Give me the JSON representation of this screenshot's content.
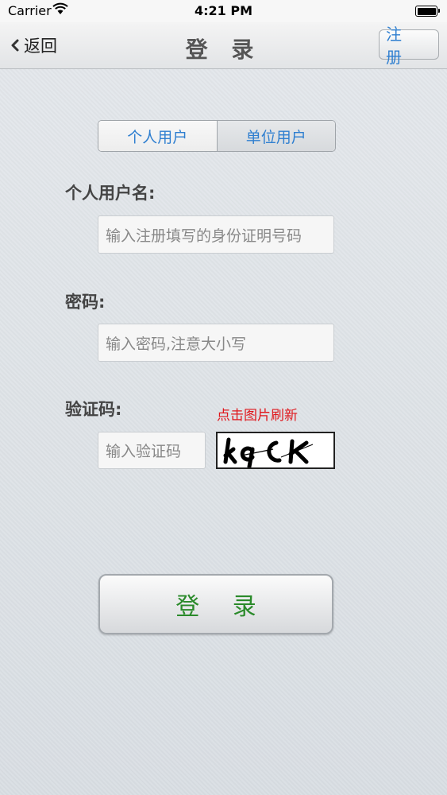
{
  "status_bar": {
    "carrier": "Carrier",
    "time": "4:21 PM"
  },
  "nav": {
    "back_label": "返回",
    "title": "登 录",
    "register_label": "注 册"
  },
  "segment": {
    "personal": "个人用户",
    "organization": "单位用户",
    "selected": "personal"
  },
  "form": {
    "username_label": "个人用户名:",
    "username_placeholder": "输入注册填写的身份证明号码",
    "password_label": "密码:",
    "password_placeholder": "输入密码,注意大小写",
    "captcha_label": "验证码:",
    "captcha_placeholder": "输入验证码",
    "refresh_hint": "点击图片刷新",
    "captcha_text": "kqCK"
  },
  "login_button": "登 录",
  "colors": {
    "accent_blue": "#2f7fd0",
    "hint_red": "#e0161b",
    "login_green": "#2a8a2a"
  }
}
